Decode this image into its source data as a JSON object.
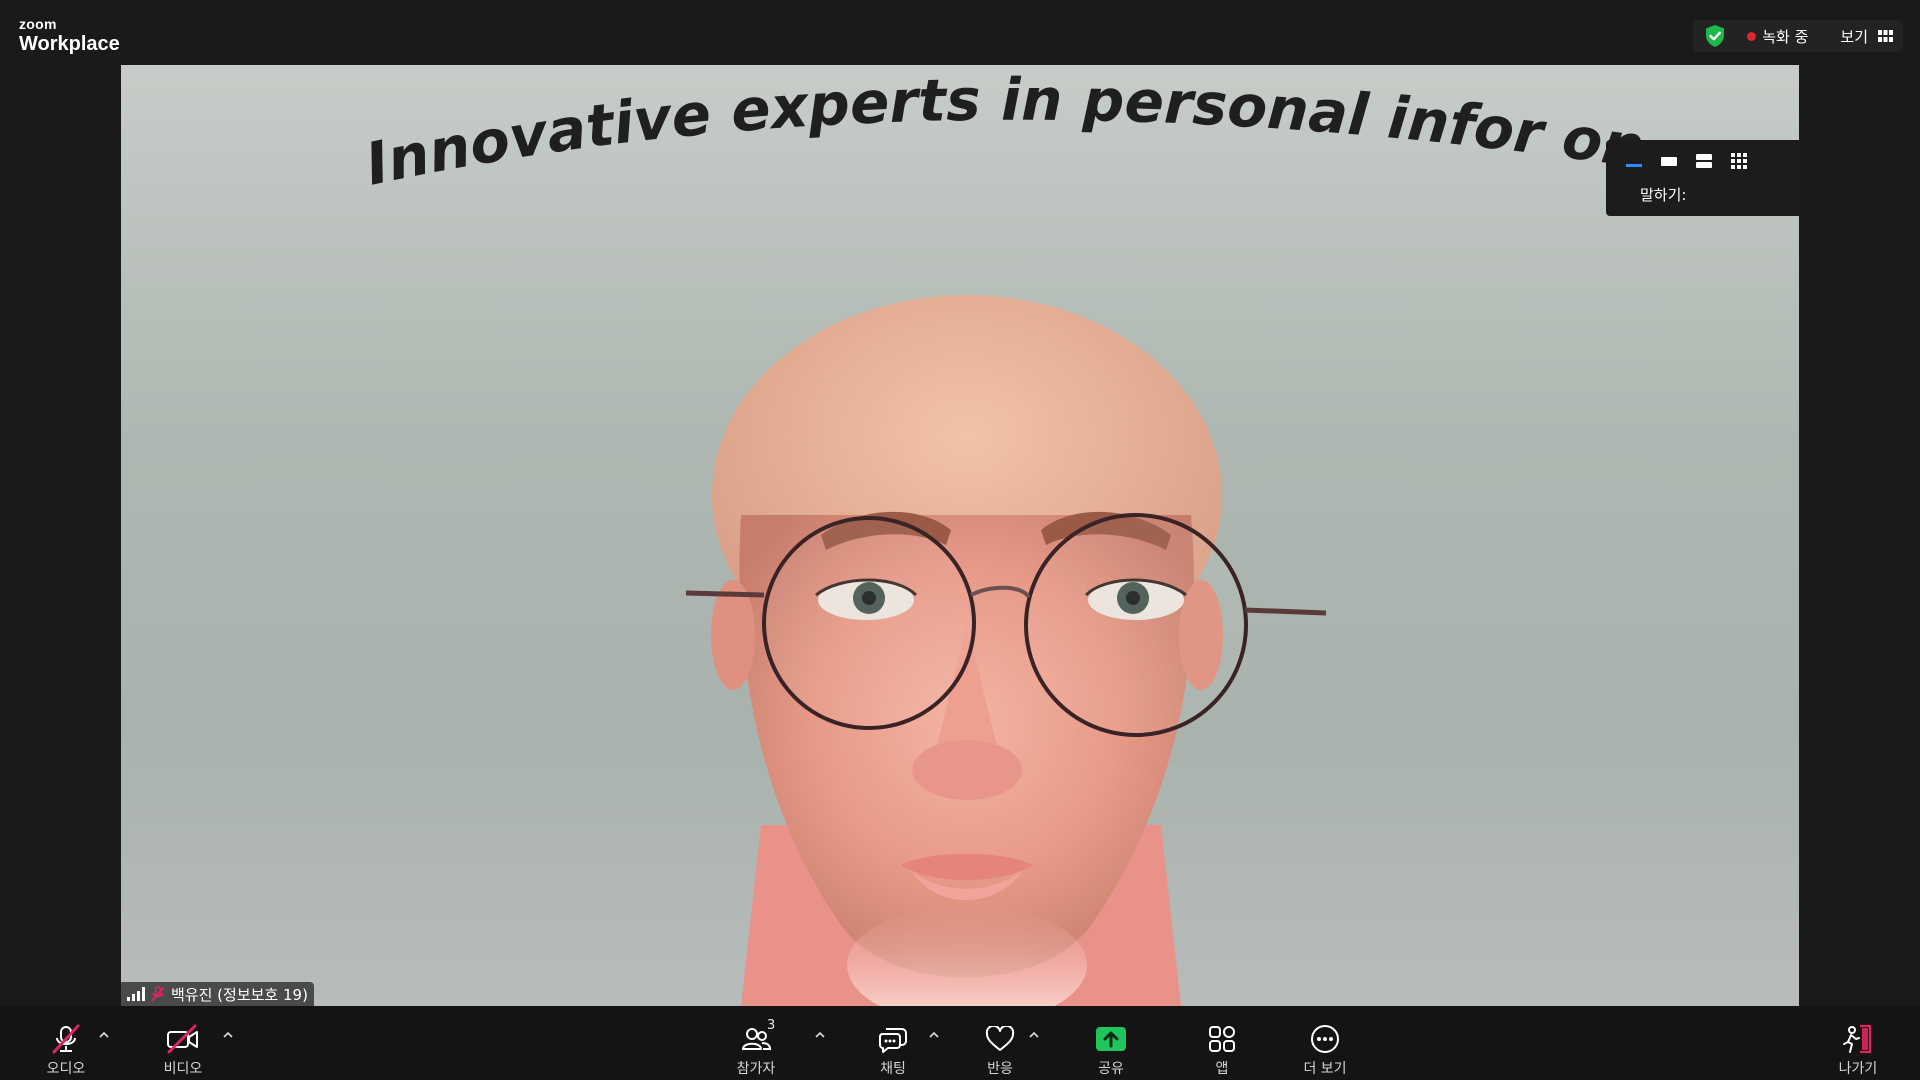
{
  "app": {
    "brand_small": "zoom",
    "brand_big": "Workplace"
  },
  "header": {
    "recording_label": "녹화 중",
    "view_label": "보기",
    "security_color": "#1fb84a",
    "recording_color": "#e02828"
  },
  "video": {
    "banner_text": "Innovative experts in personal infor",
    "banner_text_right": "on pr",
    "participant_name": "백유진 (정보보호 19)"
  },
  "view_panel": {
    "speaking_label": "말하기:",
    "icons": [
      "minimize-icon",
      "speaker-view-icon",
      "stacked-view-icon",
      "gallery-view-icon"
    ],
    "active_color": "#2d8cff"
  },
  "toolbar": {
    "audio_label": "오디오",
    "video_label": "비디오",
    "participants_label": "참가자",
    "participants_count": "3",
    "chat_label": "채팅",
    "reactions_label": "반응",
    "share_label": "공유",
    "apps_label": "앱",
    "more_label": "더 보기",
    "leave_label": "나가기",
    "share_color": "#21c55d",
    "muted_color": "#e0245e"
  }
}
